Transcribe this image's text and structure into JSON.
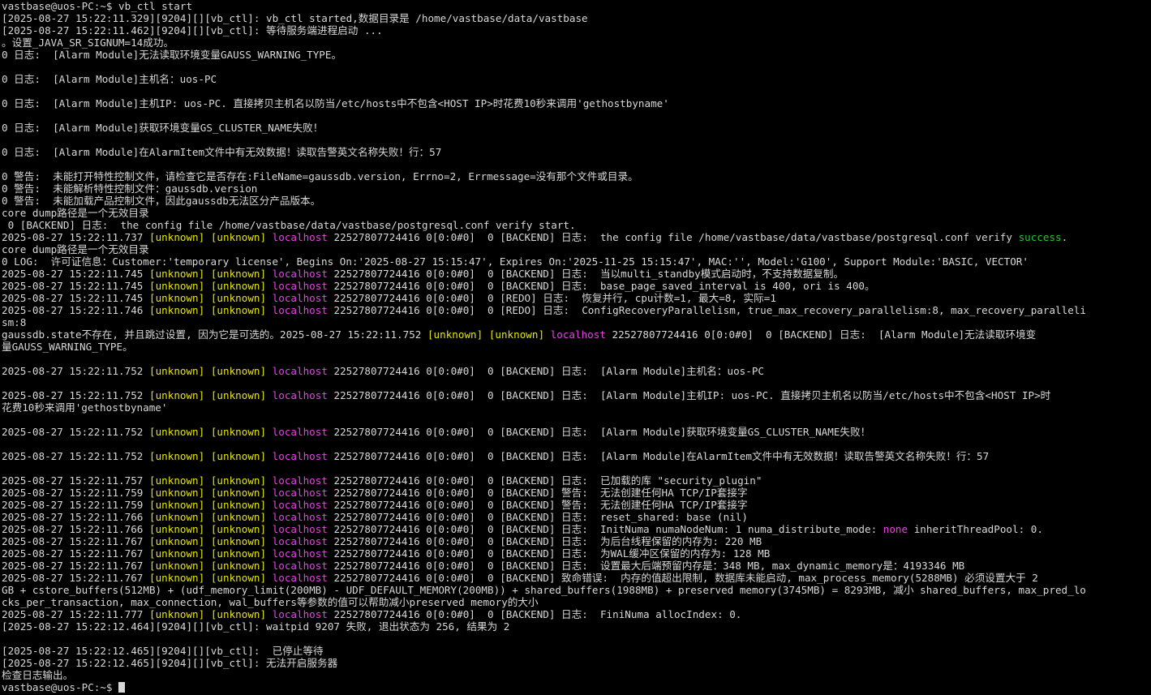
{
  "window": {
    "prompt": "vastbase@uos-PC:~$ "
  },
  "colors": {
    "background": "#000000",
    "text": "#d8d8d8",
    "unknown_field": "#e5e510",
    "host_field": "#e444e4",
    "success": "#22c82a"
  },
  "terminal": {
    "lines": [
      [
        {
          "t": "vastbase@uos-PC:~$ vb_ctl start",
          "c": "default"
        }
      ],
      [
        {
          "t": "[2025-08-27 15:22:11.329][9204][][vb_ctl]: vb_ctl started,数据目录是 /home/vastbase/data/vastbase",
          "c": "default"
        }
      ],
      [
        {
          "t": "[2025-08-27 15:22:11.462][9204][][vb_ctl]: 等待服务端进程启动 ...",
          "c": "default"
        }
      ],
      [
        {
          "t": "。设置_JAVA_SR_SIGNUM=14成功。",
          "c": "default"
        }
      ],
      [
        {
          "t": "0 日志:  [Alarm Module]无法读取环境变量GAUSS_WARNING_TYPE。",
          "c": "default"
        }
      ],
      [],
      [
        {
          "t": "0 日志:  [Alarm Module]主机名：uos-PC",
          "c": "default"
        }
      ],
      [],
      [
        {
          "t": "0 日志:  [Alarm Module]主机IP: uos-PC. 直接拷贝主机名以防当/etc/hosts中不包含<HOST IP>时花费10秒来调用'gethostbyname'",
          "c": "default"
        }
      ],
      [],
      [
        {
          "t": "0 日志:  [Alarm Module]获取环境变量GS_CLUSTER_NAME失败！",
          "c": "default"
        }
      ],
      [],
      [
        {
          "t": "0 日志:  [Alarm Module]在AlarmItem文件中有无效数据！读取告警英文名称失败！行：57",
          "c": "default"
        }
      ],
      [],
      [
        {
          "t": "0 警告:  未能打开特性控制文件，请检查它是否存在:FileName=gaussdb.version, Errno=2, Errmessage=没有那个文件或目录。",
          "c": "default"
        }
      ],
      [
        {
          "t": "0 警告:  未能解析特性控制文件：gaussdb.version",
          "c": "default"
        }
      ],
      [
        {
          "t": "0 警告:  未能加载产品控制文件，因此gaussdb无法区分产品版本。",
          "c": "default"
        }
      ],
      [
        {
          "t": "core dump路径是一个无效目录",
          "c": "default"
        }
      ],
      [
        {
          "t": " 0 [BACKEND] 日志:  the config file /home/vastbase/data/vastbase/postgresql.conf verify start.",
          "c": "default"
        }
      ],
      [
        {
          "t": "2025-08-27 15:22:11.737 ",
          "c": "default"
        },
        {
          "t": "[unknown]",
          "c": "yellow"
        },
        {
          "t": " ",
          "c": "default"
        },
        {
          "t": "[unknown]",
          "c": "yellow"
        },
        {
          "t": " ",
          "c": "default"
        },
        {
          "t": "localhost",
          "c": "magenta"
        },
        {
          "t": " 22527807724416 0[0:0#0]  0 [BACKEND] 日志:  the config file /home/vastbase/data/vastbase/postgresql.conf verify ",
          "c": "default"
        },
        {
          "t": "success",
          "c": "green"
        },
        {
          "t": ".",
          "c": "default"
        }
      ],
      [
        {
          "t": "core dump路径是一个无效目录",
          "c": "default"
        }
      ],
      [
        {
          "t": "0 LOG:  许可证信息：Customer:'temporary license', Begins On:'2025-08-27 15:15:47', Expires On:'2025-11-25 15:15:47', MAC:'', Model:'G100', Support Module:'BASIC, VECTOR'",
          "c": "default"
        }
      ],
      [
        {
          "t": "2025-08-27 15:22:11.745 ",
          "c": "default"
        },
        {
          "t": "[unknown]",
          "c": "yellow"
        },
        {
          "t": " ",
          "c": "default"
        },
        {
          "t": "[unknown]",
          "c": "yellow"
        },
        {
          "t": " ",
          "c": "default"
        },
        {
          "t": "localhost",
          "c": "magenta"
        },
        {
          "t": " 22527807724416 0[0:0#0]  0 [BACKEND] 日志:  当以multi_standby模式启动时，不支持数据复制。",
          "c": "default"
        }
      ],
      [
        {
          "t": "2025-08-27 15:22:11.745 ",
          "c": "default"
        },
        {
          "t": "[unknown]",
          "c": "yellow"
        },
        {
          "t": " ",
          "c": "default"
        },
        {
          "t": "[unknown]",
          "c": "yellow"
        },
        {
          "t": " ",
          "c": "default"
        },
        {
          "t": "localhost",
          "c": "magenta"
        },
        {
          "t": " 22527807724416 0[0:0#0]  0 [BACKEND] 日志:  base_page_saved_interval is 400, ori is 400。",
          "c": "default"
        }
      ],
      [
        {
          "t": "2025-08-27 15:22:11.745 ",
          "c": "default"
        },
        {
          "t": "[unknown]",
          "c": "yellow"
        },
        {
          "t": " ",
          "c": "default"
        },
        {
          "t": "[unknown]",
          "c": "yellow"
        },
        {
          "t": " ",
          "c": "default"
        },
        {
          "t": "localhost",
          "c": "magenta"
        },
        {
          "t": " 22527807724416 0[0:0#0]  0 [REDO] 日志:  恢复并行, cpu计数=1, 最大=8, 实际=1",
          "c": "default"
        }
      ],
      [
        {
          "t": "2025-08-27 15:22:11.746 ",
          "c": "default"
        },
        {
          "t": "[unknown]",
          "c": "yellow"
        },
        {
          "t": " ",
          "c": "default"
        },
        {
          "t": "[unknown]",
          "c": "yellow"
        },
        {
          "t": " ",
          "c": "default"
        },
        {
          "t": "localhost",
          "c": "magenta"
        },
        {
          "t": " 22527807724416 0[0:0#0]  0 [REDO] 日志:  ConfigRecoveryParallelism, true_max_recovery_parallelism:8, max_recovery_paralleli",
          "c": "default"
        }
      ],
      [
        {
          "t": "sm:8",
          "c": "default"
        }
      ],
      [
        {
          "t": "gaussdb.state不存在, 并且跳过设置, 因为它是可选的。2025-08-27 15:22:11.752 ",
          "c": "default"
        },
        {
          "t": "[unknown]",
          "c": "yellow"
        },
        {
          "t": " ",
          "c": "default"
        },
        {
          "t": "[unknown]",
          "c": "yellow"
        },
        {
          "t": " ",
          "c": "default"
        },
        {
          "t": "localhost",
          "c": "magenta"
        },
        {
          "t": " 22527807724416 0[0:0#0]  0 [BACKEND] 日志:  [Alarm Module]无法读取环境变",
          "c": "default"
        }
      ],
      [
        {
          "t": "量GAUSS_WARNING_TYPE。",
          "c": "default"
        }
      ],
      [],
      [
        {
          "t": "2025-08-27 15:22:11.752 ",
          "c": "default"
        },
        {
          "t": "[unknown]",
          "c": "yellow"
        },
        {
          "t": " ",
          "c": "default"
        },
        {
          "t": "[unknown]",
          "c": "yellow"
        },
        {
          "t": " ",
          "c": "default"
        },
        {
          "t": "localhost",
          "c": "magenta"
        },
        {
          "t": " 22527807724416 0[0:0#0]  0 [BACKEND] 日志:  [Alarm Module]主机名：uos-PC",
          "c": "default"
        }
      ],
      [],
      [
        {
          "t": "2025-08-27 15:22:11.752 ",
          "c": "default"
        },
        {
          "t": "[unknown]",
          "c": "yellow"
        },
        {
          "t": " ",
          "c": "default"
        },
        {
          "t": "[unknown]",
          "c": "yellow"
        },
        {
          "t": " ",
          "c": "default"
        },
        {
          "t": "localhost",
          "c": "magenta"
        },
        {
          "t": " 22527807724416 0[0:0#0]  0 [BACKEND] 日志:  [Alarm Module]主机IP: uos-PC. 直接拷贝主机名以防当/etc/hosts中不包含<HOST IP>时",
          "c": "default"
        }
      ],
      [
        {
          "t": "花费10秒来调用'gethostbyname'",
          "c": "default"
        }
      ],
      [],
      [
        {
          "t": "2025-08-27 15:22:11.752 ",
          "c": "default"
        },
        {
          "t": "[unknown]",
          "c": "yellow"
        },
        {
          "t": " ",
          "c": "default"
        },
        {
          "t": "[unknown]",
          "c": "yellow"
        },
        {
          "t": " ",
          "c": "default"
        },
        {
          "t": "localhost",
          "c": "magenta"
        },
        {
          "t": " 22527807724416 0[0:0#0]  0 [BACKEND] 日志:  [Alarm Module]获取环境变量GS_CLUSTER_NAME失败！",
          "c": "default"
        }
      ],
      [],
      [
        {
          "t": "2025-08-27 15:22:11.752 ",
          "c": "default"
        },
        {
          "t": "[unknown]",
          "c": "yellow"
        },
        {
          "t": " ",
          "c": "default"
        },
        {
          "t": "[unknown]",
          "c": "yellow"
        },
        {
          "t": " ",
          "c": "default"
        },
        {
          "t": "localhost",
          "c": "magenta"
        },
        {
          "t": " 22527807724416 0[0:0#0]  0 [BACKEND] 日志:  [Alarm Module]在AlarmItem文件中有无效数据！读取告警英文名称失败！行：57",
          "c": "default"
        }
      ],
      [],
      [
        {
          "t": "2025-08-27 15:22:11.757 ",
          "c": "default"
        },
        {
          "t": "[unknown]",
          "c": "yellow"
        },
        {
          "t": " ",
          "c": "default"
        },
        {
          "t": "[unknown]",
          "c": "yellow"
        },
        {
          "t": " ",
          "c": "default"
        },
        {
          "t": "localhost",
          "c": "magenta"
        },
        {
          "t": " 22527807724416 0[0:0#0]  0 [BACKEND] 日志:  已加载的库 \"security_plugin\"",
          "c": "default"
        }
      ],
      [
        {
          "t": "2025-08-27 15:22:11.759 ",
          "c": "default"
        },
        {
          "t": "[unknown]",
          "c": "yellow"
        },
        {
          "t": " ",
          "c": "default"
        },
        {
          "t": "[unknown]",
          "c": "yellow"
        },
        {
          "t": " ",
          "c": "default"
        },
        {
          "t": "localhost",
          "c": "magenta"
        },
        {
          "t": " 22527807724416 0[0:0#0]  0 [BACKEND] 警告:  无法创建任何HA TCP/IP套接字",
          "c": "default"
        }
      ],
      [
        {
          "t": "2025-08-27 15:22:11.759 ",
          "c": "default"
        },
        {
          "t": "[unknown]",
          "c": "yellow"
        },
        {
          "t": " ",
          "c": "default"
        },
        {
          "t": "[unknown]",
          "c": "yellow"
        },
        {
          "t": " ",
          "c": "default"
        },
        {
          "t": "localhost",
          "c": "magenta"
        },
        {
          "t": " 22527807724416 0[0:0#0]  0 [BACKEND] 警告:  无法创建任何HA TCP/IP套接字",
          "c": "default"
        }
      ],
      [
        {
          "t": "2025-08-27 15:22:11.766 ",
          "c": "default"
        },
        {
          "t": "[unknown]",
          "c": "yellow"
        },
        {
          "t": " ",
          "c": "default"
        },
        {
          "t": "[unknown]",
          "c": "yellow"
        },
        {
          "t": " ",
          "c": "default"
        },
        {
          "t": "localhost",
          "c": "magenta"
        },
        {
          "t": " 22527807724416 0[0:0#0]  0 [BACKEND] 日志:  reset_shared: base (nil)",
          "c": "default"
        }
      ],
      [
        {
          "t": "2025-08-27 15:22:11.766 ",
          "c": "default"
        },
        {
          "t": "[unknown]",
          "c": "yellow"
        },
        {
          "t": " ",
          "c": "default"
        },
        {
          "t": "[unknown]",
          "c": "yellow"
        },
        {
          "t": " ",
          "c": "default"
        },
        {
          "t": "localhost",
          "c": "magenta"
        },
        {
          "t": " 22527807724416 0[0:0#0]  0 [BACKEND] 日志:  InitNuma numaNodeNum: 1 numa_distribute_mode: ",
          "c": "default"
        },
        {
          "t": "none",
          "c": "magenta"
        },
        {
          "t": " inheritThreadPool: 0.",
          "c": "default"
        }
      ],
      [
        {
          "t": "2025-08-27 15:22:11.767 ",
          "c": "default"
        },
        {
          "t": "[unknown]",
          "c": "yellow"
        },
        {
          "t": " ",
          "c": "default"
        },
        {
          "t": "[unknown]",
          "c": "yellow"
        },
        {
          "t": " ",
          "c": "default"
        },
        {
          "t": "localhost",
          "c": "magenta"
        },
        {
          "t": " 22527807724416 0[0:0#0]  0 [BACKEND] 日志:  为后台线程保留的内存为: 220 MB",
          "c": "default"
        }
      ],
      [
        {
          "t": "2025-08-27 15:22:11.767 ",
          "c": "default"
        },
        {
          "t": "[unknown]",
          "c": "yellow"
        },
        {
          "t": " ",
          "c": "default"
        },
        {
          "t": "[unknown]",
          "c": "yellow"
        },
        {
          "t": " ",
          "c": "default"
        },
        {
          "t": "localhost",
          "c": "magenta"
        },
        {
          "t": " 22527807724416 0[0:0#0]  0 [BACKEND] 日志:  为WAL缓冲区保留的内存为: 128 MB",
          "c": "default"
        }
      ],
      [
        {
          "t": "2025-08-27 15:22:11.767 ",
          "c": "default"
        },
        {
          "t": "[unknown]",
          "c": "yellow"
        },
        {
          "t": " ",
          "c": "default"
        },
        {
          "t": "[unknown]",
          "c": "yellow"
        },
        {
          "t": " ",
          "c": "default"
        },
        {
          "t": "localhost",
          "c": "magenta"
        },
        {
          "t": " 22527807724416 0[0:0#0]  0 [BACKEND] 日志:  设置最大后端预留内存是：348 MB, max_dynamic_memory是：4193346 MB",
          "c": "default"
        }
      ],
      [
        {
          "t": "2025-08-27 15:22:11.767 ",
          "c": "default"
        },
        {
          "t": "[unknown]",
          "c": "yellow"
        },
        {
          "t": " ",
          "c": "default"
        },
        {
          "t": "[unknown]",
          "c": "yellow"
        },
        {
          "t": " ",
          "c": "default"
        },
        {
          "t": "localhost",
          "c": "magenta"
        },
        {
          "t": " 22527807724416 0[0:0#0]  0 [BACKEND] 致命错误:  内存的值超出限制, 数据库未能启动, max_process_memory(5288MB) 必须设置大于 2",
          "c": "default"
        }
      ],
      [
        {
          "t": "GB + cstore_buffers(512MB) + (udf_memory_limit(200MB) - UDF_DEFAULT_MEMORY(200MB)) + shared_buffers(1988MB) + preserved memory(3745MB) = 8293MB, 减小 shared_buffers, max_pred_lo",
          "c": "default"
        }
      ],
      [
        {
          "t": "cks_per_transaction, max_connection, wal_buffers等参数的值可以帮助减小preserved memory的大小",
          "c": "default"
        }
      ],
      [
        {
          "t": "2025-08-27 15:22:11.777 ",
          "c": "default"
        },
        {
          "t": "[unknown]",
          "c": "yellow"
        },
        {
          "t": " ",
          "c": "default"
        },
        {
          "t": "[unknown]",
          "c": "yellow"
        },
        {
          "t": " ",
          "c": "default"
        },
        {
          "t": "localhost",
          "c": "magenta"
        },
        {
          "t": " 22527807724416 0[0:0#0]  0 [BACKEND] 日志:  FiniNuma allocIndex: 0.",
          "c": "default"
        }
      ],
      [
        {
          "t": "[2025-08-27 15:22:12.464][9204][][vb_ctl]: waitpid 9207 失败, 退出状态为 256, 结果为 2",
          "c": "default"
        }
      ],
      [],
      [
        {
          "t": "[2025-08-27 15:22:12.465][9204][][vb_ctl]:  已停止等待",
          "c": "default"
        }
      ],
      [
        {
          "t": "[2025-08-27 15:22:12.465][9204][][vb_ctl]: 无法开启服务器",
          "c": "default"
        }
      ],
      [
        {
          "t": "检查日志输出。",
          "c": "default"
        }
      ]
    ]
  }
}
